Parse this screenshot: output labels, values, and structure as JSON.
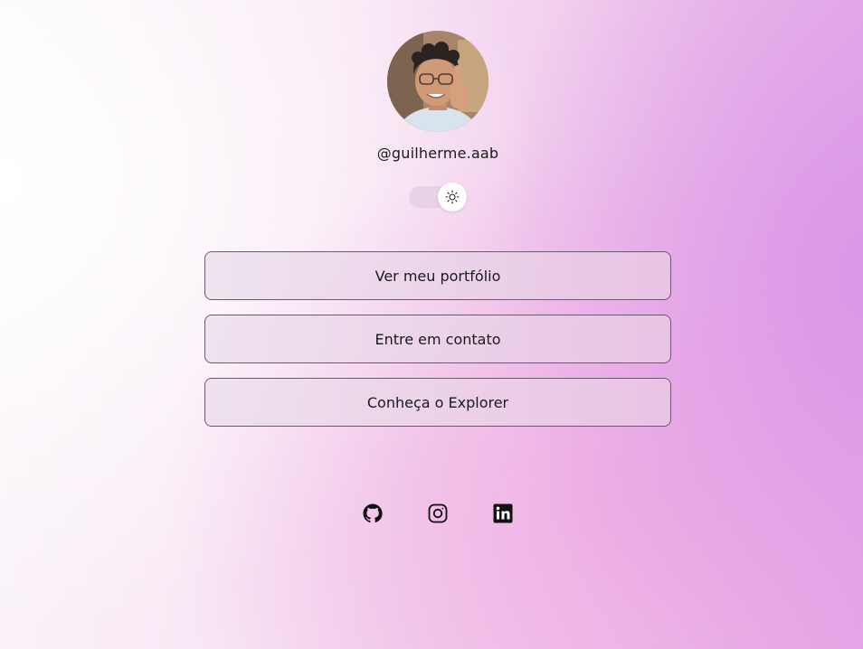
{
  "profile": {
    "username": "@guilherme.aab",
    "avatar_icon": "profile-photo"
  },
  "theme_toggle": {
    "icon": "sun-icon",
    "state": "light"
  },
  "links": [
    {
      "label": "Ver meu portfólio"
    },
    {
      "label": "Entre em contato"
    },
    {
      "label": "Conheça o Explorer"
    }
  ],
  "social": [
    {
      "icon": "github-icon"
    },
    {
      "icon": "instagram-icon"
    },
    {
      "icon": "linkedin-icon"
    }
  ],
  "colors": {
    "accent": "#e2a6e6",
    "button_border": "#6b5a6d",
    "text": "#1a1a1a"
  }
}
